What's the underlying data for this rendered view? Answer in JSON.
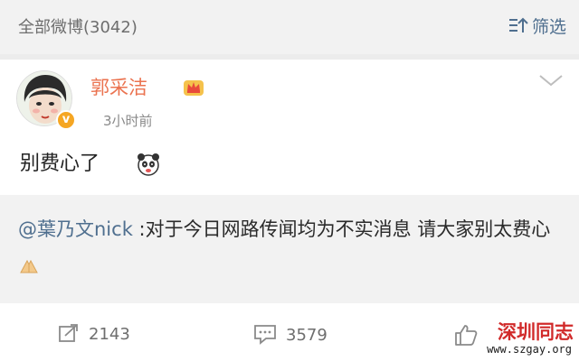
{
  "header": {
    "title": "全部微博(3042)",
    "filter_label": "筛选",
    "filter_icon": "filter-sort-icon"
  },
  "post": {
    "username": "郭采洁",
    "badge_icon": "vip-crown-icon",
    "verified_icon": "verified-v-icon",
    "verified_letter": "v",
    "timestamp": "3小时前",
    "text": "别费心了",
    "emoji_icon": "panda-emoji-icon",
    "menu_icon": "chevron-down-icon"
  },
  "repost": {
    "mention": "@葉乃文nick",
    "text": " :对于今日网路传闻均为不实消息 请大家别太费心",
    "emoji_icon": "praying-hands-emoji-icon"
  },
  "actions": {
    "repost_count": "2143",
    "comment_count": "3579",
    "repost_icon": "repost-icon",
    "comment_icon": "comment-icon",
    "like_icon": "thumbs-up-icon"
  },
  "watermark": {
    "title": "深圳同志",
    "url": "www.szgay.org"
  },
  "colors": {
    "username": "#eb7350",
    "link": "#4f6f8f",
    "badge": "#f5a623",
    "watermark": "#d12a2a"
  }
}
